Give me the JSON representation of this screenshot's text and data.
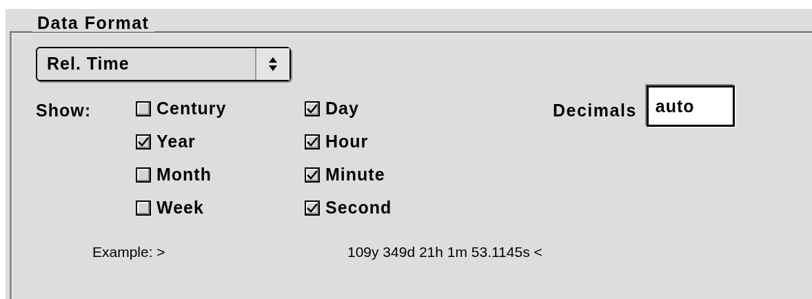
{
  "group": {
    "title": "Data Format"
  },
  "format_select": {
    "value": "Rel. Time"
  },
  "show_label": "Show:",
  "options": [
    {
      "label": "Century",
      "checked": false
    },
    {
      "label": "Year",
      "checked": true
    },
    {
      "label": "Month",
      "checked": false
    },
    {
      "label": "Week",
      "checked": false
    },
    {
      "label": "Day",
      "checked": true
    },
    {
      "label": "Hour",
      "checked": true
    },
    {
      "label": "Minute",
      "checked": true
    },
    {
      "label": "Second",
      "checked": true
    }
  ],
  "decimals": {
    "label": "Decimals",
    "value": "auto"
  },
  "example": {
    "label": "Example: >",
    "value": "109y 349d 21h 1m 53.1145s <"
  }
}
